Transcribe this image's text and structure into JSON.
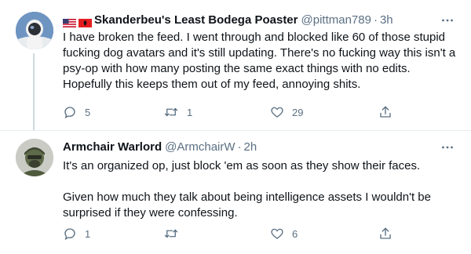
{
  "tweets": [
    {
      "display_name": "Skanderbeu's Least Bodega Poaster",
      "handle": "@pittman789",
      "separator": "·",
      "time": "3h",
      "flags": [
        "us-flag-icon",
        "albania-flag-icon"
      ],
      "text": "I have broken the feed. I went through and blocked like 60 of those stupid\nfucking dog avatars and it's still updating. There's no fucking way this isn't a\npsy-op with how many posting the same exact things with no edits.\nHopefully this keeps them out of my feed, annoying shits.",
      "replies": "5",
      "retweets": "1",
      "likes": "29"
    },
    {
      "display_name": "Armchair Warlord",
      "handle": "@ArmchairW",
      "separator": "·",
      "time": "2h",
      "text": "It's an organized op, just block 'em as soon as they show their faces.\n\nGiven how much they talk about being intelligence assets I wouldn't be\nsurprised if they were confessing.",
      "replies": "1",
      "retweets": "",
      "likes": "6"
    }
  ],
  "colors": {
    "text_primary": "#0f1419",
    "text_secondary": "#5b7083",
    "thread_line": "#cfd9de",
    "divider": "#e6ecf0"
  },
  "icons": {
    "reply": "reply-icon",
    "retweet": "retweet-icon",
    "like": "heart-icon",
    "share": "share-icon",
    "more": "more-options-icon"
  }
}
